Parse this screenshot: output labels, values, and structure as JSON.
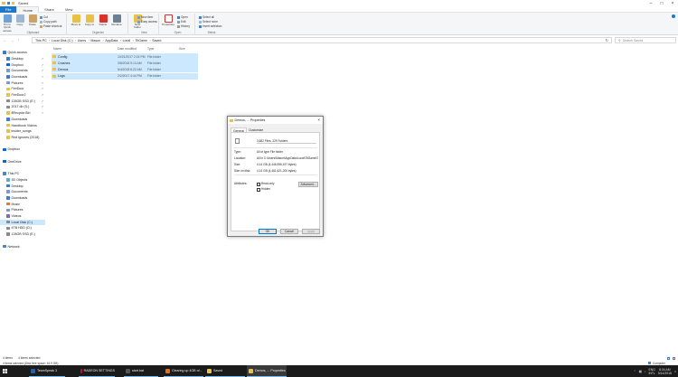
{
  "window": {
    "title": "Saved",
    "controls": [
      "minimize-icon",
      "maximize-icon",
      "close-icon"
    ]
  },
  "ribbon_tabs": [
    "File",
    "Home",
    "Share",
    "View"
  ],
  "ribbon": {
    "clipboard": {
      "pin_label": "Pin to Quick access",
      "copy_label": "Copy",
      "paste_label": "Paste",
      "cut_label": "Cut",
      "copy_path_label": "Copy path",
      "paste_shortcut_label": "Paste shortcut",
      "group_label": "Clipboard"
    },
    "organize": {
      "move_to_label": "Move to",
      "copy_to_label": "Copy to",
      "delete_label": "Delete",
      "rename_label": "Rename",
      "group_label": "Organize"
    },
    "new": {
      "new_folder_label": "New folder",
      "new_item_label": "New item",
      "easy_access_label": "Easy access",
      "group_label": "New"
    },
    "open": {
      "properties_label": "Properties",
      "open_label": "Open",
      "edit_label": "Edit",
      "history_label": "History",
      "group_label": "Open"
    },
    "select": {
      "select_all_label": "Select all",
      "select_none_label": "Select none",
      "invert_label": "Invert selection",
      "group_label": "Select"
    }
  },
  "address": {
    "crumbs": [
      "This PC",
      "Local Disk (C:)",
      "Users",
      "Mason",
      "AppData",
      "Local",
      "TitGame",
      "Saved"
    ],
    "search_placeholder": "Search Saved"
  },
  "nav": {
    "items": [
      {
        "label": "Quick access",
        "icon": "star-icon",
        "pinned": false
      },
      {
        "label": "Desktop",
        "icon": "desktop-icon",
        "pinned": true
      },
      {
        "label": "Dropbox",
        "icon": "dropbox-icon",
        "pinned": true
      },
      {
        "label": "Documents",
        "icon": "documents-icon",
        "pinned": true
      },
      {
        "label": "Downloads",
        "icon": "downloads-icon",
        "pinned": true
      },
      {
        "label": "Pictures",
        "icon": "pictures-icon",
        "pinned": true
      },
      {
        "label": "FireDoor",
        "icon": "folder-icon",
        "pinned": true
      },
      {
        "label": "FireDoor2",
        "icon": "folder-icon",
        "pinned": true
      },
      {
        "label": "128GB SSD (E:)",
        "icon": "drive-icon",
        "pinned": true
      },
      {
        "label": "2017 db (S:)",
        "icon": "drive-icon",
        "pinned": true
      },
      {
        "label": "$Recycle.Bin",
        "icon": "folder-icon",
        "pinned": true
      },
      {
        "label": "Downloads",
        "icon": "downloads-icon",
        "pinned": false
      },
      {
        "label": "Handbook Videos",
        "icon": "folder-icon",
        "pinned": false
      },
      {
        "label": "insider_songs",
        "icon": "folder-icon",
        "pinned": false
      },
      {
        "label": "Red Ignores (2018)",
        "icon": "folder-icon",
        "pinned": false
      },
      {
        "label": "",
        "icon": "",
        "pinned": false
      },
      {
        "label": "Dropbox",
        "icon": "dropbox-icon",
        "pinned": false
      },
      {
        "label": "",
        "icon": "",
        "pinned": false
      },
      {
        "label": "OneDrive",
        "icon": "onedrive-icon",
        "pinned": false
      },
      {
        "label": "",
        "icon": "",
        "pinned": false
      },
      {
        "label": "This PC",
        "icon": "pc-icon",
        "pinned": false
      },
      {
        "label": "3D Objects",
        "icon": "cube-icon",
        "pinned": false
      },
      {
        "label": "Desktop",
        "icon": "desktop-icon",
        "pinned": false
      },
      {
        "label": "Documents",
        "icon": "documents-icon",
        "pinned": false
      },
      {
        "label": "Downloads",
        "icon": "downloads-icon",
        "pinned": false
      },
      {
        "label": "Music",
        "icon": "music-icon",
        "pinned": false
      },
      {
        "label": "Pictures",
        "icon": "pictures-icon",
        "pinned": false
      },
      {
        "label": "Videos",
        "icon": "videos-icon",
        "pinned": false
      },
      {
        "label": "Local Disk (C:)",
        "icon": "drive-icon",
        "pinned": false,
        "selected": true
      },
      {
        "label": "4TB HDD (D:)",
        "icon": "drive-icon",
        "pinned": false
      },
      {
        "label": "128GB SSD (E:)",
        "icon": "drive-icon",
        "pinned": false
      },
      {
        "label": "",
        "icon": "",
        "pinned": false
      },
      {
        "label": "Network",
        "icon": "network-icon",
        "pinned": false
      }
    ]
  },
  "columns": [
    "Name",
    "Date modified",
    "Type",
    "Size"
  ],
  "files": [
    {
      "name": "Config",
      "date": "10/21/2017 2:24 PM",
      "type": "File folder"
    },
    {
      "name": "Crashes",
      "date": "3/8/2018 9:13 AM",
      "type": "File folder"
    },
    {
      "name": "Demos",
      "date": "5/4/2018 8:22 AM",
      "type": "File folder"
    },
    {
      "name": "Logs",
      "date": "2/2/2017 4:44 PM",
      "type": "File folder"
    }
  ],
  "status": {
    "count": "4 items",
    "selected": "4 items selected"
  },
  "dialog": {
    "title": "Demos, ... Properties",
    "tabs": [
      "General",
      "Customize"
    ],
    "summary": "3,682 Files, 229 Folders",
    "type_label": "Type:",
    "type_value": "All of type File folder",
    "location_label": "Location:",
    "location_value": "All in C:\\Users\\Mason\\AppData\\Local\\TitGame\\Sav",
    "size_label": "Size:",
    "size_value": "4.14 GB (4,446,596,197 bytes)",
    "disk_label": "Size on disk:",
    "disk_value": "4.14 GB (4,461,621,200 bytes)",
    "attributes_label": "Attributes:",
    "readonly_label": "Read-only",
    "hidden_label": "Hidden",
    "advanced_label": "Advanced...",
    "ok_label": "OK",
    "cancel_label": "Cancel",
    "apply_label": "Apply"
  },
  "taskbar": {
    "items": [
      {
        "label": "TeamSpeak 3",
        "icon": "teamspeak-icon"
      },
      {
        "label": "RADEON SETTINGS",
        "icon": "radeon-icon"
      },
      {
        "label": "start.bat",
        "icon": "file-icon"
      },
      {
        "label": "Clearing up 4GB of...",
        "icon": "browser-icon"
      },
      {
        "label": "Saved",
        "icon": "explorer-icon"
      },
      {
        "label": "Demos, ... Properties",
        "icon": "explorer-icon"
      }
    ],
    "tray_lang": "ENG",
    "tray_region": "INTL",
    "clock_time": "8:34 AM",
    "clock_date": "5/14/2018",
    "drive_status": "4 items selected (Disk free space: 61.9 GB)",
    "computer_label": "Computer"
  }
}
